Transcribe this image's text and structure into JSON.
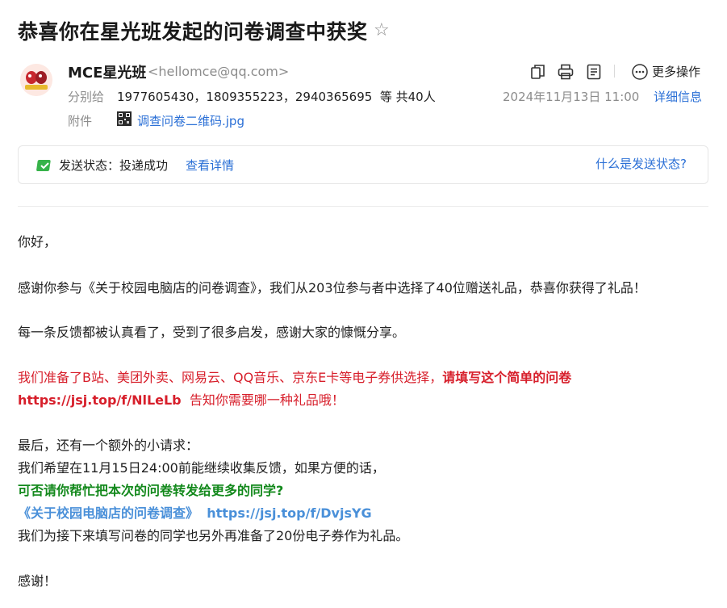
{
  "mail": {
    "subject": "恭喜你在星光班发起的问卷调查中获奖",
    "sender_name": "MCE星光班",
    "sender_email": "<hellomce@qq.com>",
    "to_label": "分别给",
    "to_list": "1977605430，1809355223，2940365695",
    "to_more": "等 共40人",
    "attachment_label": "附件",
    "attachment_name": "调查问卷二维码.jpg",
    "date": "2024年11月13日 11:00",
    "details_link": "详细信息",
    "more_actions": "更多操作"
  },
  "status": {
    "label": "发送状态：投递成功",
    "detail_link": "查看详情",
    "help_link": "什么是发送状态?"
  },
  "body": {
    "greeting": "你好，",
    "p1": "感谢你参与《关于校园电脑店的问卷调查》，我们从203位参与者中选择了40位赠送礼品，恭喜你获得了礼品！",
    "p2": "每一条反馈都被认真看了，受到了很多启发，感谢大家的慷慨分享。",
    "p3a": "我们准备了B站、美团外卖、网易云、QQ音乐、京东E卡等电子券供选择，",
    "p3b": "请填写这个简单的问卷",
    "p3_link": "https://jsj.top/f/NlLeLb",
    "p3c": "告知你需要哪一种礼品哦！",
    "p4": "最后，还有一个额外的小请求：",
    "p5": "我们希望在11月15日24:00前能继续收集反馈，如果方便的话，",
    "p6": "可否请你帮忙把本次的问卷转发给更多的同学?",
    "p7_title": "《关于校园电脑店的问卷调查》",
    "p7_link": "https://jsj.top/f/DvjsYG",
    "p8": "我们为接下来填写问卷的同学也另外再准备了20份电子券作为礼品。",
    "thanks": "感谢！"
  },
  "icons": [
    "star-icon",
    "avatar-logo",
    "copy-icon",
    "print-icon",
    "note-icon",
    "more-icon",
    "attachment-thumbnail-icon",
    "check-icon"
  ],
  "colors": {
    "link": "#2a6fd6",
    "red": "#d71f2b",
    "green": "#13891c",
    "light_blue": "#4a90d9"
  }
}
